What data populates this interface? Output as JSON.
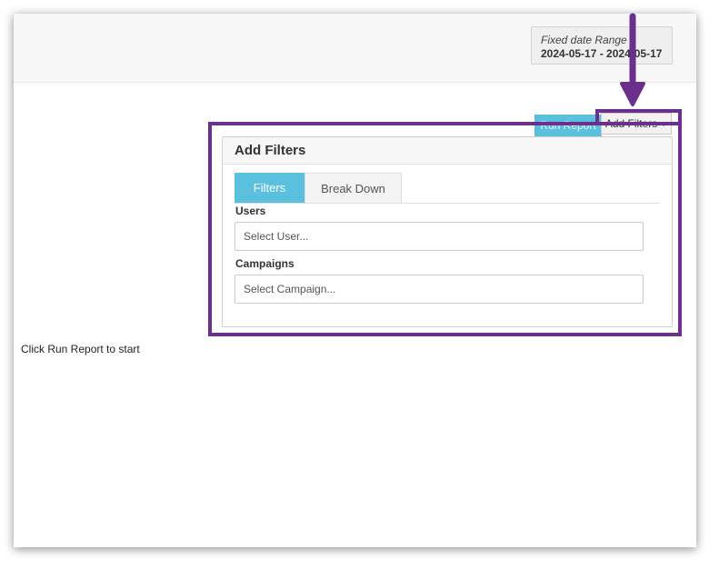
{
  "date_range": {
    "title": "Fixed date Range",
    "value": "2024-05-17 - 2024-05-17"
  },
  "toolbar": {
    "run_report_label": "Run Report",
    "add_filters_label": "Add Filters",
    "add_filters_caret": "▼"
  },
  "filters_panel": {
    "title": "Add Filters",
    "tabs": [
      {
        "label": "Filters",
        "active": true
      },
      {
        "label": "Break Down",
        "active": false
      }
    ],
    "users_label": "Users",
    "users_placeholder": "Select User...",
    "campaigns_label": "Campaigns",
    "campaigns_placeholder": "Select Campaign..."
  },
  "status": {
    "message": "Click Run Report to start"
  },
  "colors": {
    "accent": "#5bc0de",
    "annotation": "#6b2f8e"
  }
}
